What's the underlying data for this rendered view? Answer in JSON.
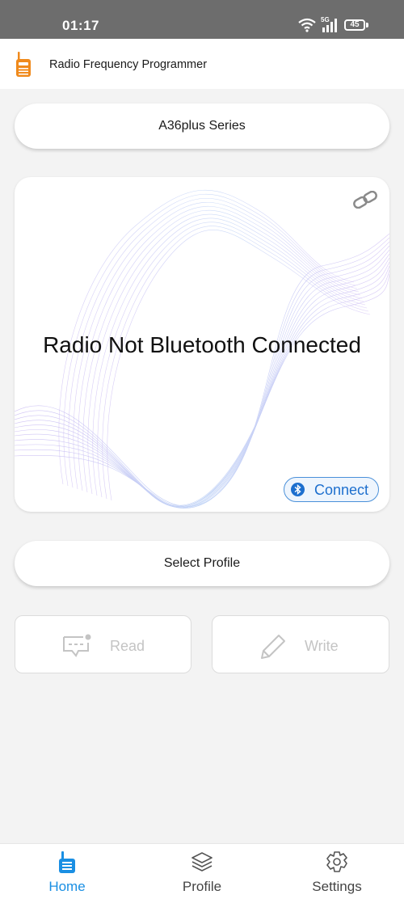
{
  "status_bar": {
    "time": "01:17",
    "network": "5G",
    "battery": "45"
  },
  "app_bar": {
    "title": "Radio Frequency Programmer",
    "icon": "walkie-talkie-icon"
  },
  "series_button": {
    "label": "A36plus Series"
  },
  "connection_card": {
    "status_text": "Radio Not Bluetooth Connected",
    "link_icon": "link-icon",
    "connect_button": {
      "label": "Connect",
      "icon": "bluetooth-icon"
    }
  },
  "profile_button": {
    "label": "Select Profile"
  },
  "actions": {
    "read": {
      "label": "Read",
      "icon": "message-icon",
      "enabled": false
    },
    "write": {
      "label": "Write",
      "icon": "pen-icon",
      "enabled": false
    }
  },
  "bottom_nav": {
    "items": [
      {
        "label": "Home",
        "icon": "walkie-talkie-icon",
        "active": true
      },
      {
        "label": "Profile",
        "icon": "layers-icon",
        "active": false
      },
      {
        "label": "Settings",
        "icon": "gear-icon",
        "active": false
      }
    ]
  },
  "colors": {
    "accent": "#1a8fe3",
    "brand_orange": "#f08a1c",
    "disabled": "#c4c4c4",
    "background": "#f3f3f3"
  }
}
